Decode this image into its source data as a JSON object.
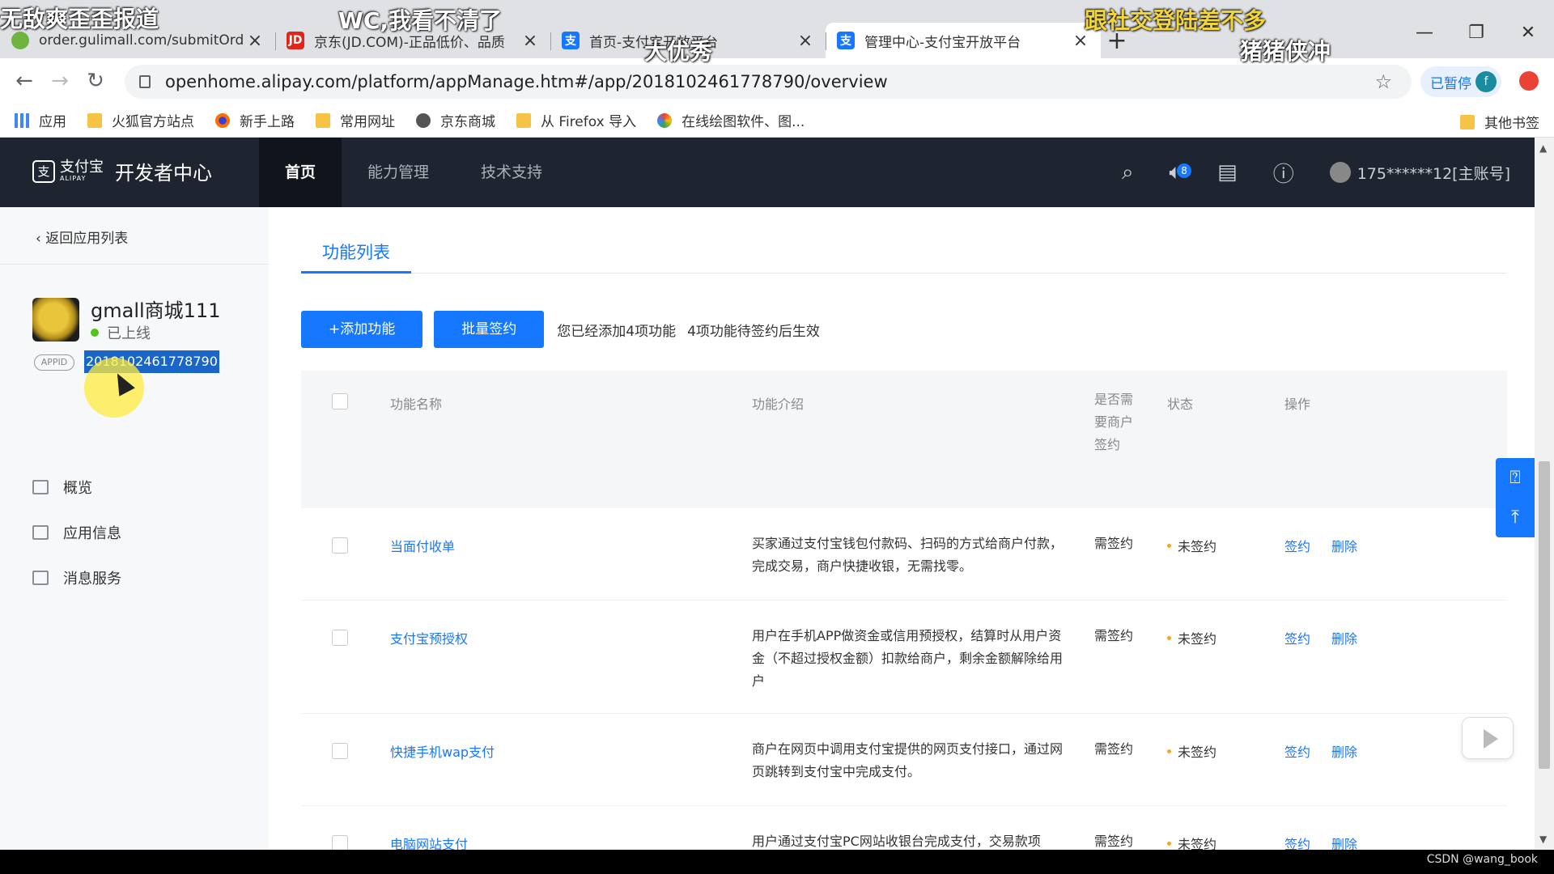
{
  "browser": {
    "tabs": [
      {
        "title": "order.gulimall.com/submitOrd",
        "active": false,
        "fav_color": "#6fb43f"
      },
      {
        "title": "京东(JD.COM)-正品低价、品质",
        "active": false,
        "fav_color": "#e1251b",
        "fav_text": "JD"
      },
      {
        "title": "首页-支付宝开放平台",
        "active": false,
        "fav_color": "#1677ff",
        "fav_text": "支"
      },
      {
        "title": "管理中心-支付宝开放平台",
        "active": true,
        "fav_color": "#1677ff",
        "fav_text": "支"
      }
    ],
    "url": "openhome.alipay.com/platform/appManage.htm#/app/2018102461778790/overview",
    "paused_label": "已暂停",
    "profile_initial": "f",
    "bookmarks": [
      {
        "label": "应用",
        "icon": "apps-grid-icon"
      },
      {
        "label": "火狐官方站点",
        "icon": "folder-icon"
      },
      {
        "label": "新手上路",
        "icon": "firefox-icon"
      },
      {
        "label": "常用网址",
        "icon": "folder-icon"
      },
      {
        "label": "京东商城",
        "icon": "globe-icon"
      },
      {
        "label": "从 Firefox 导入",
        "icon": "folder-icon"
      },
      {
        "label": "在线绘图软件、图...",
        "icon": "draw-icon"
      }
    ],
    "other_bookmarks": "其他书签"
  },
  "header": {
    "brand": "支付宝",
    "brand_sub": "ALIPAY",
    "dev_center": "开发者中心",
    "nav": [
      "首页",
      "能力管理",
      "技术支持"
    ],
    "active_nav": 0,
    "notify_count": "8",
    "account": "175******12[主账号]"
  },
  "sidebar": {
    "back_label": "返回应用列表",
    "app_name": "gmall商城111",
    "status": "已上线",
    "appid_tag": "APPID",
    "appid": "2018102461778790",
    "menu": [
      {
        "label": "概览",
        "icon": "overview-icon"
      },
      {
        "label": "应用信息",
        "icon": "app-info-icon"
      },
      {
        "label": "消息服务",
        "icon": "message-service-icon"
      }
    ]
  },
  "main": {
    "tab": "功能列表",
    "add_button": "+添加功能",
    "batch_button": "批量签约",
    "note1": "您已经添加4项功能",
    "note2": "4项功能待签约后生效",
    "columns": {
      "name": "功能名称",
      "desc": "功能介绍",
      "need": "是否需要商户签约",
      "state": "状态",
      "op": "操作"
    },
    "rows": [
      {
        "name": "当面付收单",
        "desc": "买家通过支付宝钱包付款码、扫码的方式给商户付款，完成交易，商户快捷收银，无需找零。",
        "need": "需签约",
        "state": "未签约",
        "sign": "签约",
        "delete": "删除"
      },
      {
        "name": "支付宝预授权",
        "desc": "用户在手机APP做资金或信用预授权，结算时从用户资金（不超过授权金额）扣款给商户，剩余金额解除给用户",
        "need": "需签约",
        "state": "未签约",
        "sign": "签约",
        "delete": "删除"
      },
      {
        "name": "快捷手机wap支付",
        "desc": "商户在网页中调用支付宝提供的网页支付接口，通过网页跳转到支付宝中完成支付。",
        "need": "需签约",
        "state": "未签约",
        "sign": "签约",
        "delete": "删除"
      },
      {
        "name": "电脑网站支付",
        "desc": "用户通过支付宝PC网站收银台完成支付，交易款项",
        "need": "需签约",
        "state": "未签约",
        "sign": "签约",
        "delete": "删除"
      }
    ]
  },
  "overlay": {
    "danmaku": [
      {
        "text": "无敌爽歪歪报道",
        "color": "white"
      },
      {
        "text": "WC,我看不清了",
        "color": "white"
      },
      {
        "text": "跟社交登陆差不多",
        "color": "yellow"
      },
      {
        "text": "大优秀",
        "color": "white"
      },
      {
        "text": "猪猪侠冲",
        "color": "white"
      }
    ],
    "watermark": "CSDN @wang_book"
  }
}
